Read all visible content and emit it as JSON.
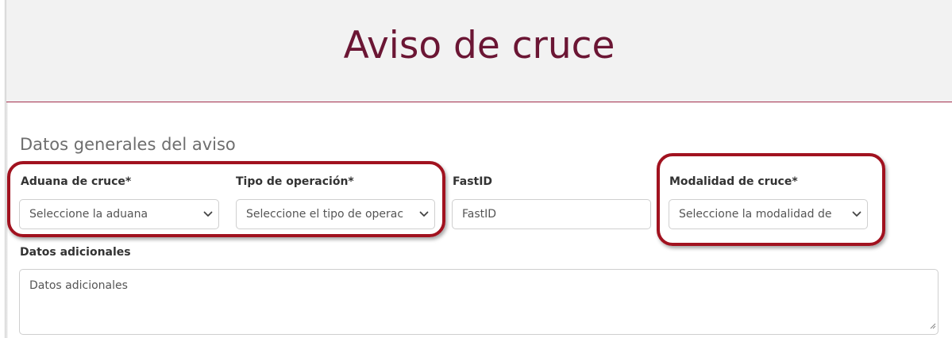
{
  "page": {
    "title": "Aviso de cruce",
    "section_title": "Datos generales del aviso"
  },
  "form": {
    "aduana": {
      "label": "Aduana de cruce*",
      "placeholder": "Seleccione la aduana"
    },
    "tipo_operacion": {
      "label": "Tipo de operación*",
      "placeholder": "Seleccione el tipo de operac"
    },
    "fastid": {
      "label": "FastID",
      "placeholder": "FastID"
    },
    "modalidad": {
      "label": "Modalidad de cruce*",
      "placeholder": "Seleccione la modalidad de"
    },
    "datos_adicionales": {
      "label": "Datos adicionales",
      "placeholder": "Datos adicionales"
    }
  },
  "icons": {
    "dropdown": "chevron-down-icon",
    "resize": "resize-grip-icon"
  },
  "colors": {
    "title": "#6b1634",
    "header_border": "#a6324f",
    "highlight": "#a1121f"
  }
}
